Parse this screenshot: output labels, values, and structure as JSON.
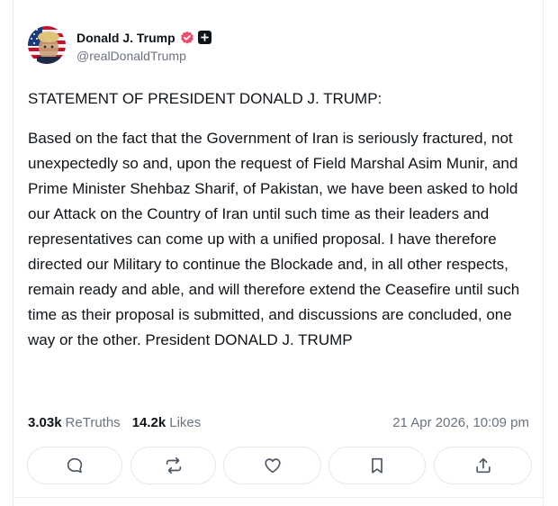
{
  "author": {
    "display_name": "Donald J. Trump",
    "handle": "@realDonaldTrump",
    "avatar_icon": "avatar-flag-portrait",
    "verified_icon": "verified-badge-icon",
    "verified_color": "#e94f6a"
  },
  "post": {
    "title": "STATEMENT OF PRESIDENT DONALD J. TRUMP:",
    "body": "Based on the fact that the Government of Iran is seriously fractured, not unexpectedly so and, upon the request of Field Marshal Asim Munir, and Prime Minister Shehbaz Sharif, of Pakistan, we have been asked to hold our Attack on the Country of Iran until such time as their leaders and representatives can come up with a unified proposal. I have therefore directed our Military to continue the Blockade and, in all other respects, remain ready and able, and will therefore extend the Ceasefire until such time as their proposal is submitted, and discussions are concluded, one way or the other. President DONALD J. TRUMP"
  },
  "stats": {
    "retruths_count": "3.03k",
    "retruths_label": "ReTruths",
    "likes_count": "14.2k",
    "likes_label": "Likes",
    "timestamp": "21 Apr 2026, 10:09 pm"
  },
  "actions": [
    {
      "name": "reply",
      "icon": "reply-icon"
    },
    {
      "name": "retruth",
      "icon": "retruth-icon"
    },
    {
      "name": "like",
      "icon": "heart-icon"
    },
    {
      "name": "bookmark",
      "icon": "bookmark-icon"
    },
    {
      "name": "share",
      "icon": "share-icon"
    }
  ]
}
